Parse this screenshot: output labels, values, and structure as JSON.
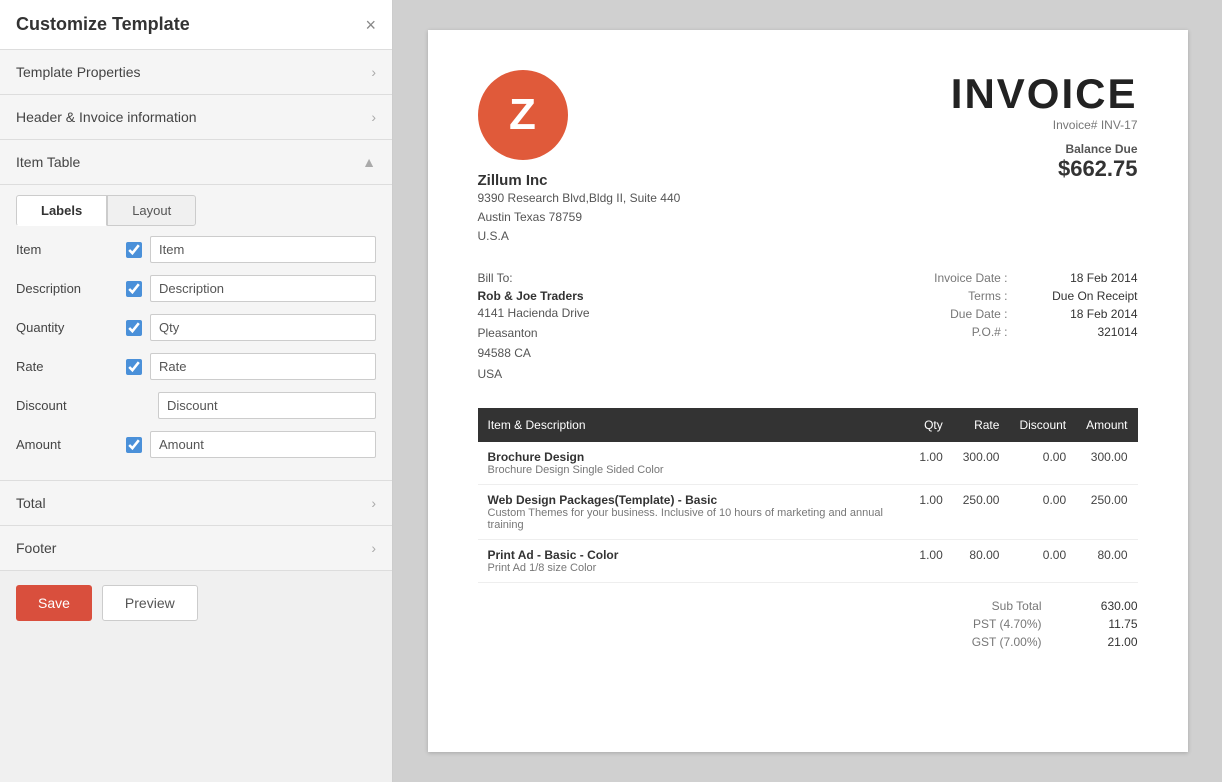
{
  "panel": {
    "title": "Customize Template",
    "close_icon": "×",
    "sections": {
      "template_properties": {
        "label": "Template Properties",
        "arrow": "›"
      },
      "header_invoice": {
        "label": "Header & Invoice information",
        "arrow": "›"
      },
      "item_table": {
        "label": "Item Table",
        "arrow": "▲"
      },
      "total": {
        "label": "Total",
        "arrow": "›"
      },
      "footer": {
        "label": "Footer",
        "arrow": "›"
      }
    },
    "tabs": [
      {
        "id": "labels",
        "label": "Labels",
        "active": true
      },
      {
        "id": "layout",
        "label": "Layout",
        "active": false
      }
    ],
    "fields": [
      {
        "id": "item",
        "label": "Item",
        "checked": true,
        "value": "Item",
        "has_checkbox": true
      },
      {
        "id": "description",
        "label": "Description",
        "checked": true,
        "value": "Description",
        "has_checkbox": true
      },
      {
        "id": "quantity",
        "label": "Quantity",
        "checked": true,
        "value": "Qty",
        "has_checkbox": true
      },
      {
        "id": "rate",
        "label": "Rate",
        "checked": true,
        "value": "Rate",
        "has_checkbox": true
      },
      {
        "id": "discount",
        "label": "Discount",
        "checked": false,
        "value": "Discount",
        "has_checkbox": false
      },
      {
        "id": "amount",
        "label": "Amount",
        "checked": true,
        "value": "Amount",
        "has_checkbox": true
      }
    ],
    "buttons": {
      "save": "Save",
      "preview": "Preview"
    }
  },
  "invoice": {
    "company": {
      "logo_letter": "Z",
      "name": "Zillum Inc",
      "address_line1": "9390 Research Blvd,Bldg II, Suite 440",
      "address_line2": "Austin Texas 78759",
      "address_line3": "U.S.A"
    },
    "title": "INVOICE",
    "number_label": "Invoice#",
    "number": "INV-17",
    "balance_due_label": "Balance Due",
    "balance_due": "$662.75",
    "bill_to_label": "Bill To:",
    "bill_to": {
      "name": "Rob & Joe Traders",
      "line1": "4141 Hacienda Drive",
      "line2": "Pleasanton",
      "line3": "94588 CA",
      "line4": "USA"
    },
    "meta": [
      {
        "key": "Invoice Date :",
        "value": "18 Feb 2014"
      },
      {
        "key": "Terms :",
        "value": "Due On Receipt"
      },
      {
        "key": "Due Date :",
        "value": "18 Feb 2014"
      },
      {
        "key": "P.O.# :",
        "value": "321014"
      }
    ],
    "table_headers": [
      {
        "id": "item_desc",
        "label": "Item & Description",
        "align": "left"
      },
      {
        "id": "qty",
        "label": "Qty",
        "align": "right"
      },
      {
        "id": "rate",
        "label": "Rate",
        "align": "right"
      },
      {
        "id": "discount",
        "label": "Discount",
        "align": "right"
      },
      {
        "id": "amount",
        "label": "Amount",
        "align": "right"
      }
    ],
    "line_items": [
      {
        "name": "Brochure Design",
        "description": "Brochure Design Single Sided Color",
        "qty": "1.00",
        "rate": "300.00",
        "discount": "0.00",
        "amount": "300.00"
      },
      {
        "name": "Web Design Packages(Template) - Basic",
        "description": "Custom Themes for your business. Inclusive of 10 hours of marketing and annual training",
        "qty": "1.00",
        "rate": "250.00",
        "discount": "0.00",
        "amount": "250.00"
      },
      {
        "name": "Print Ad - Basic - Color",
        "description": "Print Ad 1/8 size Color",
        "qty": "1.00",
        "rate": "80.00",
        "discount": "0.00",
        "amount": "80.00"
      }
    ],
    "totals": [
      {
        "label": "Sub Total",
        "value": "630.00"
      },
      {
        "label": "PST (4.70%)",
        "value": "11.75"
      },
      {
        "label": "GST (7.00%)",
        "value": "21.00"
      }
    ]
  }
}
